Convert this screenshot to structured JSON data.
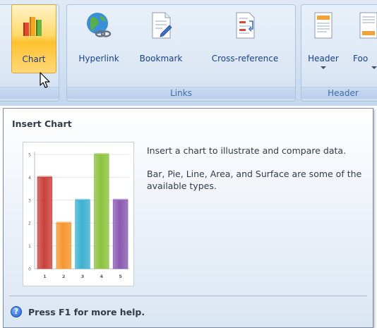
{
  "ribbon": {
    "buttons": {
      "chart": "Chart",
      "hyperlink": "Hyperlink",
      "bookmark": "Bookmark",
      "cross_reference": "Cross-reference",
      "header": "Header",
      "footer": "Foo"
    },
    "groups": {
      "links": "Links",
      "header_footer": "Header"
    }
  },
  "tooltip": {
    "title": "Insert Chart",
    "description_1": "Insert a chart to illustrate and compare data.",
    "description_2": "Bar, Pie, Line, Area, and Surface are some of the available types.",
    "help": "Press F1 for more help."
  },
  "chart_data": {
    "type": "bar",
    "categories": [
      "1",
      "2",
      "3",
      "4",
      "5"
    ],
    "values": [
      4,
      2,
      3,
      5,
      3
    ],
    "ylim": [
      0,
      5
    ],
    "yticks": [
      "0",
      "1",
      "2",
      "3",
      "4",
      "5"
    ],
    "colors": [
      "#c8403a",
      "#f6962e",
      "#3cb0d0",
      "#8cc23e",
      "#8a5ab0"
    ],
    "grid": true
  }
}
